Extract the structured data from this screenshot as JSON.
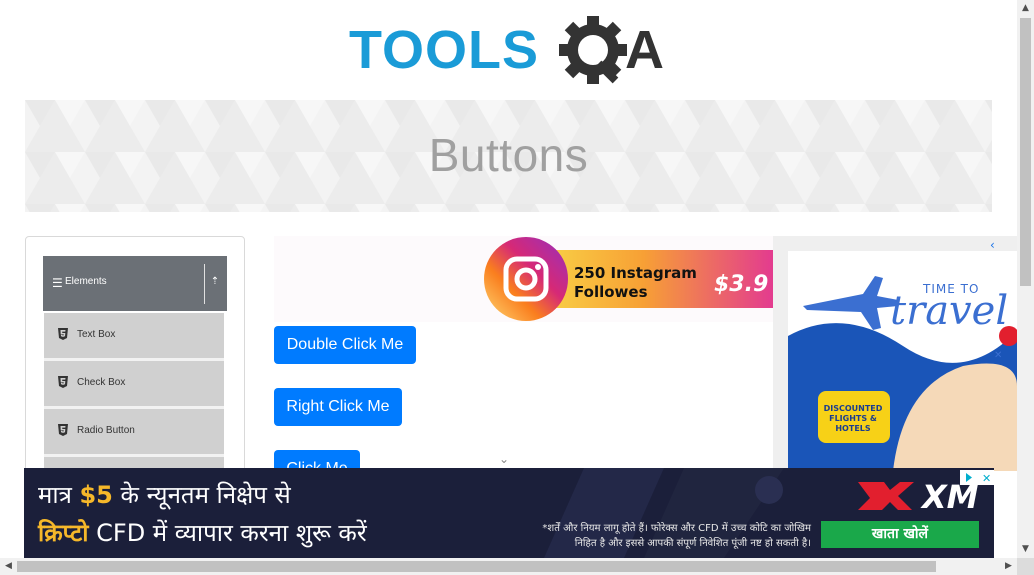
{
  "logo": {
    "text_left": "TOOLS",
    "text_right": "QA"
  },
  "banner": {
    "title": "Buttons"
  },
  "sidebar": {
    "group_title": "Elements",
    "items": [
      {
        "label": "Text Box",
        "icon": "html5-icon"
      },
      {
        "label": "Check Box",
        "icon": "html5-icon"
      },
      {
        "label": "Radio Button",
        "icon": "html5-icon"
      },
      {
        "label": "",
        "icon": "html5-icon"
      }
    ]
  },
  "buttons": {
    "double_click": "Double Click Me",
    "right_click": "Right Click Me",
    "click": "Click Me"
  },
  "ad_top": {
    "text": "250 Instagram Followes",
    "price": "$3.9"
  },
  "ad_right": {
    "headline_small": "TIME TO",
    "headline_big": "travel",
    "badge": "DISCOUNTED FLIGHTS & HOTELS"
  },
  "bottom_ad": {
    "line1_prefix": "मात्र",
    "line1_amount": "$5",
    "line1_suffix": "के न्यूनतम निक्षेप से",
    "line2_highlight": "क्रिप्टो",
    "line2_rest": "CFD में व्यापार करना शुरू करें",
    "disclaimer_1": "*शर्तें और नियम लागू होते हैं। फोरेक्स और CFD में उच्च कोटि का जोखिम",
    "disclaimer_2": "निहित है और इससे आपकी संपूर्ण निवेशित पूंजी नष्ट हो सकती है।",
    "cta": "खाता खोलें",
    "brand": "XM"
  },
  "colors": {
    "primary": "#007bff",
    "sidebar_header": "#6b7076",
    "menu_item": "#d0d0d0",
    "logo_blue": "#1a9bd7",
    "logo_dark": "#333333"
  }
}
